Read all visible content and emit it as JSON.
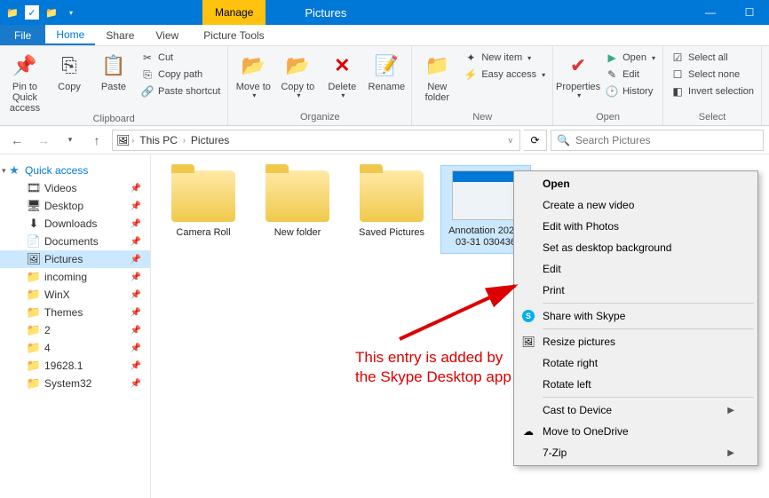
{
  "title": {
    "manage": "Manage",
    "app": "Pictures",
    "context_tab": "Picture Tools"
  },
  "tabs": {
    "file": "File",
    "home": "Home",
    "share": "Share",
    "view": "View"
  },
  "ribbon": {
    "clipboard": {
      "label": "Clipboard",
      "pin": "Pin to Quick access",
      "copy": "Copy",
      "paste": "Paste",
      "cut": "Cut",
      "copy_path": "Copy path",
      "paste_shortcut": "Paste shortcut"
    },
    "organize": {
      "label": "Organize",
      "move": "Move to",
      "copy_to": "Copy to",
      "delete": "Delete",
      "rename": "Rename"
    },
    "new": {
      "label": "New",
      "new_folder": "New folder",
      "new_item": "New item",
      "easy_access": "Easy access"
    },
    "open": {
      "label": "Open",
      "properties": "Properties",
      "open": "Open",
      "edit": "Edit",
      "history": "History"
    },
    "select": {
      "label": "Select",
      "select_all": "Select all",
      "select_none": "Select none",
      "invert": "Invert selection"
    }
  },
  "breadcrumb": {
    "pc": "This PC",
    "folder": "Pictures"
  },
  "search": {
    "placeholder": "Search Pictures"
  },
  "nav": {
    "quick_access": "Quick access",
    "items": [
      {
        "label": "Videos"
      },
      {
        "label": "Desktop"
      },
      {
        "label": "Downloads"
      },
      {
        "label": "Documents"
      },
      {
        "label": "Pictures"
      },
      {
        "label": "incoming"
      },
      {
        "label": "WinX"
      },
      {
        "label": "Themes"
      },
      {
        "label": "2"
      },
      {
        "label": "4"
      },
      {
        "label": "19628.1"
      },
      {
        "label": "System32"
      }
    ]
  },
  "files": [
    {
      "name": "Camera Roll",
      "type": "folder"
    },
    {
      "name": "New folder",
      "type": "folder"
    },
    {
      "name": "Saved Pictures",
      "type": "folder"
    },
    {
      "name": "Annotation 2020-03-31 030436",
      "type": "image"
    }
  ],
  "context_menu": [
    {
      "label": "Open",
      "bold": true
    },
    {
      "label": "Create a new video"
    },
    {
      "label": "Edit with Photos"
    },
    {
      "label": "Set as desktop background"
    },
    {
      "label": "Edit"
    },
    {
      "label": "Print"
    },
    {
      "sep": true
    },
    {
      "label": "Share with Skype",
      "icon": "skype"
    },
    {
      "sep": true
    },
    {
      "label": "Resize pictures",
      "icon": "resize"
    },
    {
      "label": "Rotate right"
    },
    {
      "label": "Rotate left"
    },
    {
      "sep": true
    },
    {
      "label": "Cast to Device",
      "submenu": true
    },
    {
      "label": "Move to OneDrive",
      "icon": "onedrive"
    },
    {
      "label": "7-Zip",
      "submenu": true
    }
  ],
  "annotation": {
    "line1": "This entry is added by",
    "line2": "the Skype Desktop app"
  }
}
